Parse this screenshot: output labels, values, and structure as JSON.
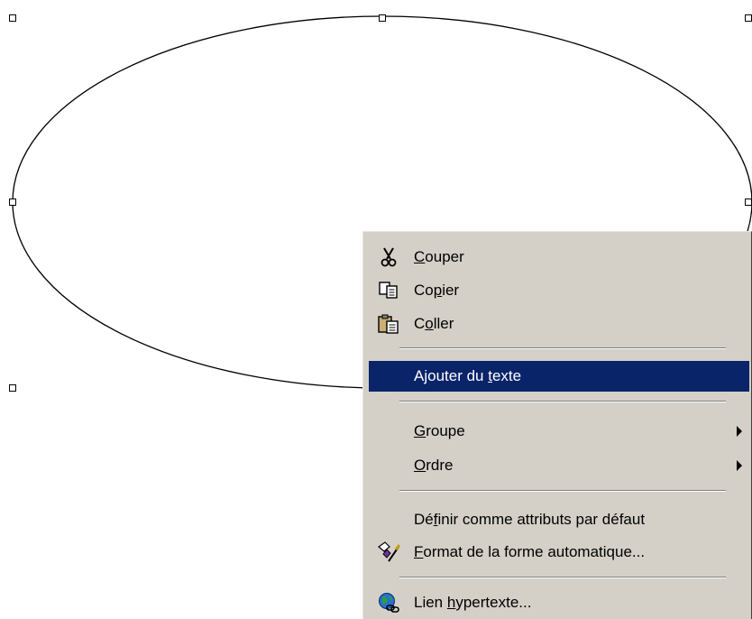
{
  "menu": {
    "items": [
      {
        "pre": "",
        "acc": "C",
        "post": "ouper",
        "icon": "scissors-icon"
      },
      {
        "pre": "Co",
        "acc": "p",
        "post": "ier",
        "icon": "copy-icon"
      },
      {
        "pre": "C",
        "acc": "o",
        "post": "ller",
        "icon": "paste-icon"
      },
      {
        "pre": "Ajouter du ",
        "acc": "t",
        "post": "exte",
        "icon": ""
      },
      {
        "pre": "",
        "acc": "G",
        "post": "roupe",
        "icon": ""
      },
      {
        "pre": "",
        "acc": "O",
        "post": "rdre",
        "icon": ""
      },
      {
        "pre": "Dé",
        "acc": "f",
        "post": "inir comme attributs par défaut",
        "icon": ""
      },
      {
        "pre": "",
        "acc": "F",
        "post": "ormat de la forme automatique...",
        "icon": "format-shape-icon"
      },
      {
        "pre": "Lien ",
        "acc": "h",
        "post": "ypertexte...",
        "icon": "hyperlink-globe-icon"
      }
    ]
  },
  "colors": {
    "menu_background": "#d4d0c8",
    "highlight": "#0a246a",
    "highlight_text": "#ffffff"
  }
}
